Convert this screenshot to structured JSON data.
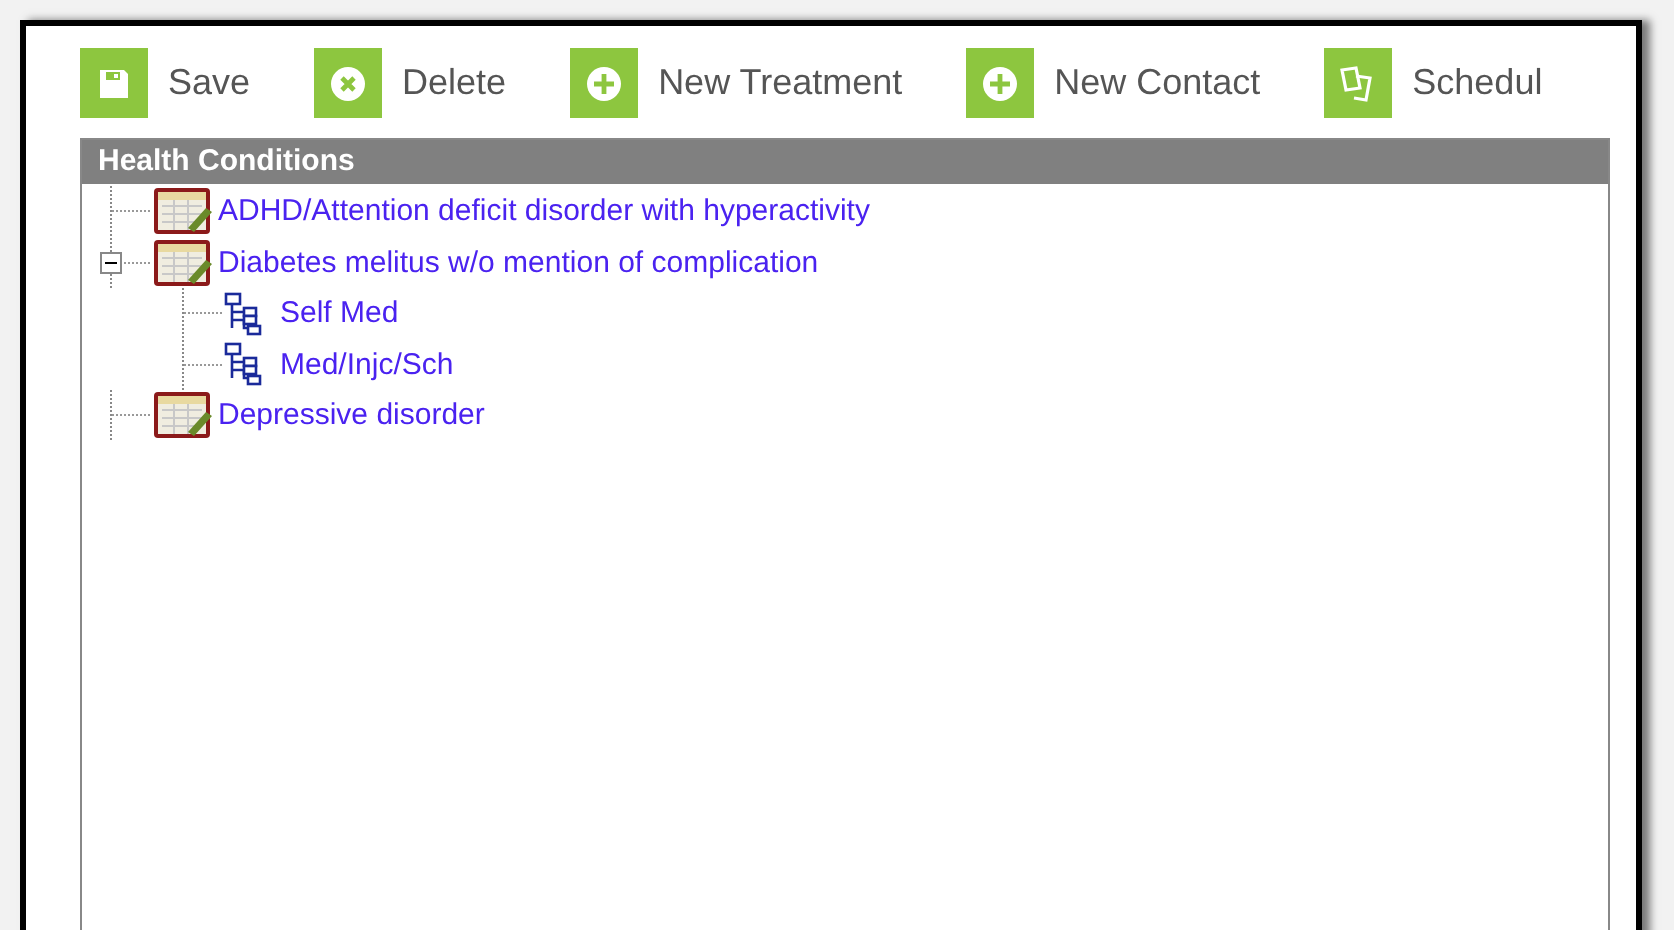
{
  "toolbar": [
    {
      "label": "Save",
      "kind": "save"
    },
    {
      "label": "Delete",
      "kind": "delete"
    },
    {
      "label": "New Treatment",
      "kind": "add"
    },
    {
      "label": "New Contact",
      "kind": "add"
    },
    {
      "label": "Schedul",
      "kind": "schedule"
    }
  ],
  "panel": {
    "title": "Health Conditions",
    "tree": [
      {
        "label": "ADHD/Attention deficit disorder with hyperactivity",
        "kind": "condition"
      },
      {
        "label": "Diabetes melitus w/o mention of complication",
        "kind": "condition",
        "expanded": true,
        "children": [
          {
            "label": "Self Med",
            "kind": "treatment"
          },
          {
            "label": "Med/Injc/Sch",
            "kind": "treatment"
          }
        ]
      },
      {
        "label": "Depressive disorder",
        "kind": "condition"
      }
    ]
  }
}
